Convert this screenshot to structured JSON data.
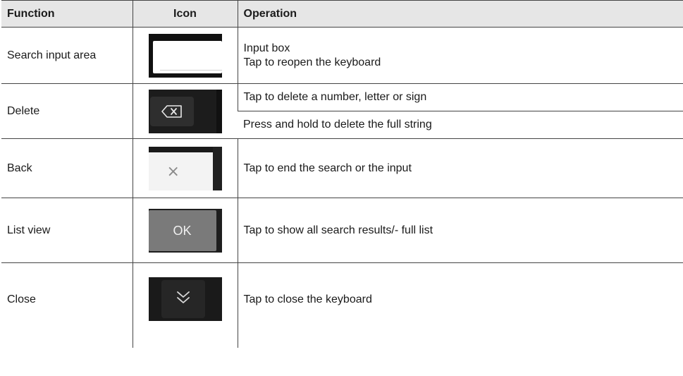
{
  "table": {
    "headers": {
      "function": "Function",
      "icon": "Icon",
      "operation": "Operation"
    },
    "rows": [
      {
        "function": "Search input area",
        "icon": "search-input-area-icon",
        "operations": [
          "Input box",
          "Tap to reopen the keyboard"
        ]
      },
      {
        "function": "Delete",
        "icon": "backspace-icon",
        "operations": [
          "Tap to delete a number, letter or sign",
          "Press and hold to delete the full string"
        ]
      },
      {
        "function": "Back",
        "icon": "close-x-icon",
        "operations": [
          "Tap to end the search or the input"
        ]
      },
      {
        "function": "List view",
        "icon": "ok-button-icon",
        "icon_label": "OK",
        "operations": [
          "Tap to show all search results/- full list"
        ]
      },
      {
        "function": "Close",
        "icon": "double-chevron-down-icon",
        "operations": [
          "Tap to close the keyboard"
        ]
      }
    ]
  }
}
